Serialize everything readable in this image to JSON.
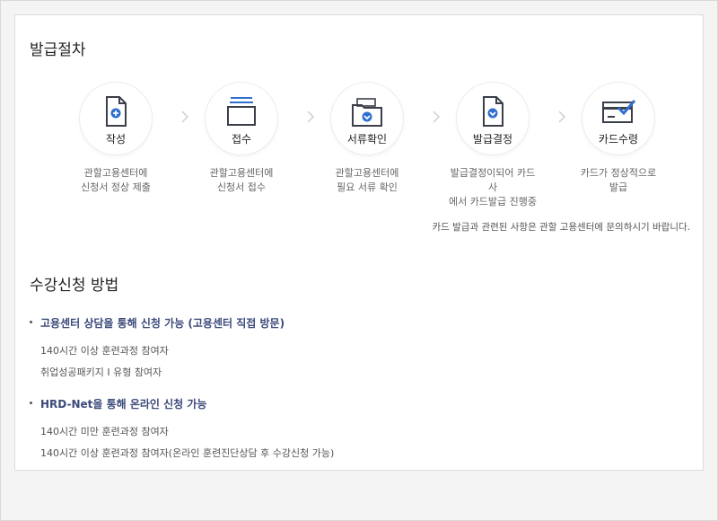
{
  "sections": {
    "issuance_title": "발급절차",
    "method_title": "수강신청 방법"
  },
  "steps": [
    {
      "title": "작성",
      "desc": "관할고용센터에\n신청서 정상 제출",
      "icon": "document-plus-icon"
    },
    {
      "title": "접수",
      "desc": "관할고용센터에\n신청서 접수",
      "icon": "stacked-tray-icon"
    },
    {
      "title": "서류확인",
      "desc": "관할고용센터에\n필요 서류 확인",
      "icon": "folder-check-icon"
    },
    {
      "title": "발급결정",
      "desc": "발급결정이되어 카드사\n에서 카드발급 진행중",
      "icon": "document-check-icon"
    },
    {
      "title": "카드수령",
      "desc": "카드가 정상적으로\n발급",
      "icon": "card-check-icon"
    }
  ],
  "notice": "카드 발급과 관련된 사항은 관할 고용센터에 문의하시기 바랍니다.",
  "methods": [
    {
      "title": "고용센터 상담을 통해 신청 가능 (고용센터 직접 방문)",
      "items": [
        "140시간 이상 훈련과정 참여자",
        "취업성공패키지 Ⅰ 유형 참여자"
      ]
    },
    {
      "title": "HRD-Net을 통해 온라인 신청 가능",
      "items": [
        "140시간 미만 훈련과정 참여자",
        "140시간 이상 훈련과정 참여자(온라인 훈련진단상담 후 수강신청 가능)"
      ]
    }
  ],
  "colors": {
    "icon_dark": "#3a3f4a",
    "icon_accent": "#2f6fd0",
    "method_title": "#3b4a7a"
  }
}
